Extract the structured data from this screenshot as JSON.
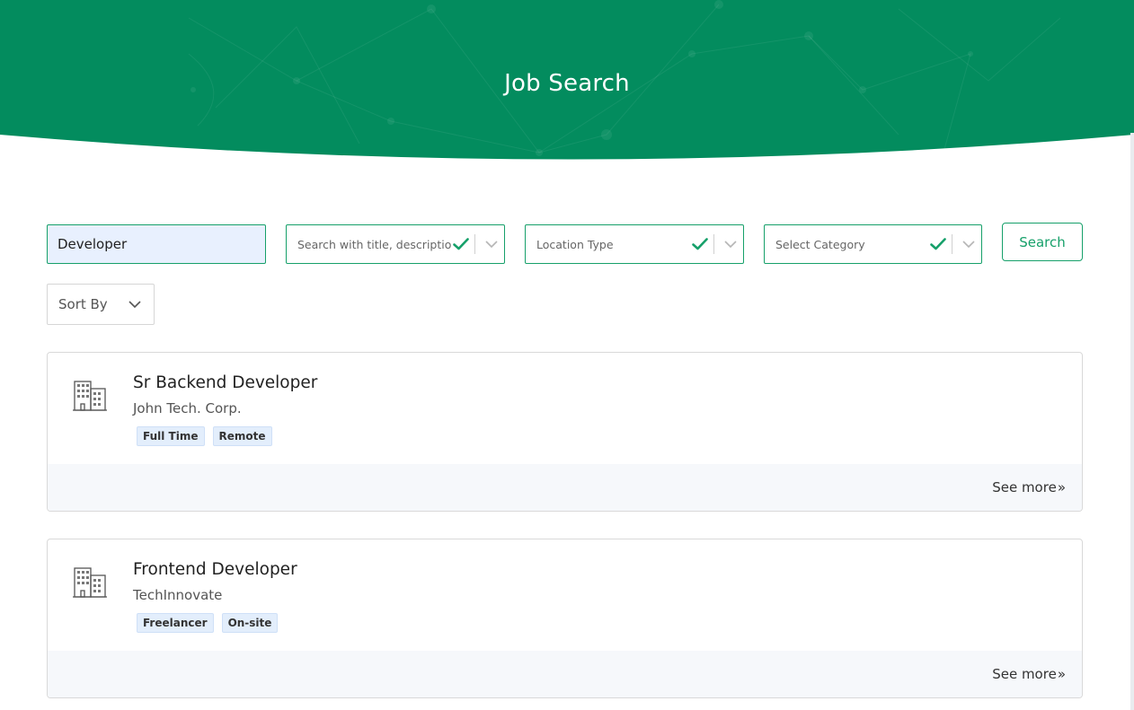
{
  "header": {
    "title": "Job Search",
    "color": "#038c5e"
  },
  "search": {
    "keyword_value": "Developer",
    "filter_text": "Search with title, description",
    "location_type": "Location Type",
    "category": "Select Category",
    "button_label": "Search"
  },
  "sort": {
    "label": "Sort By"
  },
  "jobs": [
    {
      "title": "Sr Backend Developer",
      "company": "John Tech. Corp.",
      "tags": [
        "Full Time",
        "Remote"
      ],
      "see_more": "See more",
      "icon": "building-icon"
    },
    {
      "title": "Frontend Developer",
      "company": "TechInnovate",
      "tags": [
        "Freelancer",
        "On-site"
      ],
      "see_more": "See more",
      "icon": "building-icon"
    }
  ],
  "colors": {
    "accent": "#16a06a",
    "tag_bg": "#e3eefc",
    "card_footer": "#f6f8fb"
  }
}
